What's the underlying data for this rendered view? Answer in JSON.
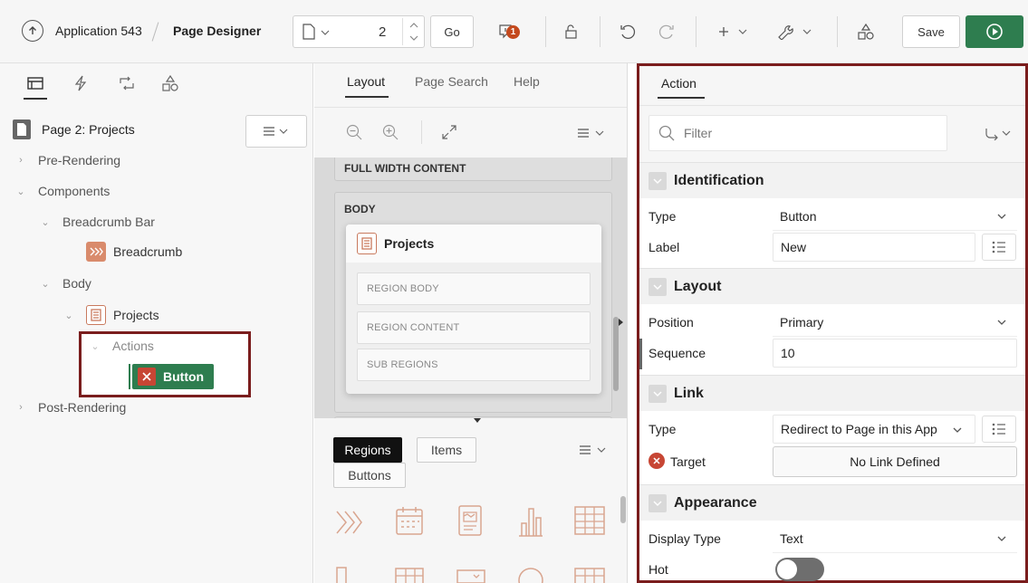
{
  "toolbar": {
    "app_label": "Application 543",
    "page_label": "Page Designer",
    "page_number": "2",
    "go_label": "Go",
    "issues_count": "1",
    "save_label": "Save"
  },
  "left": {
    "page_title": "Page 2: Projects",
    "tree": {
      "pre_rendering": "Pre-Rendering",
      "components": "Components",
      "breadcrumb_bar": "Breadcrumb Bar",
      "breadcrumb": "Breadcrumb",
      "body": "Body",
      "projects": "Projects",
      "actions": "Actions",
      "button": "Button",
      "post_rendering": "Post-Rendering"
    }
  },
  "middle": {
    "tabs": [
      "Layout",
      "Page Search",
      "Help"
    ],
    "full_width": "FULL WIDTH CONTENT",
    "body": "BODY",
    "region_title": "Projects",
    "slots": [
      "REGION BODY",
      "REGION CONTENT",
      "SUB REGIONS"
    ],
    "gallery_tabs": [
      "Regions",
      "Items",
      "Buttons"
    ]
  },
  "right": {
    "tab": "Action",
    "filter_placeholder": "Filter",
    "identification": {
      "header": "Identification",
      "type_label": "Type",
      "type_value": "Button",
      "label_label": "Label",
      "label_value": "New"
    },
    "layout": {
      "header": "Layout",
      "position_label": "Position",
      "position_value": "Primary",
      "sequence_label": "Sequence",
      "sequence_value": "10"
    },
    "link": {
      "header": "Link",
      "type_label": "Type",
      "type_value": "Redirect to Page in this App",
      "target_label": "Target",
      "target_value": "No Link Defined"
    },
    "appearance": {
      "header": "Appearance",
      "display_type_label": "Display Type",
      "display_type_value": "Text",
      "hot_label": "Hot"
    }
  },
  "colors": {
    "accent_green": "#2e7d4f",
    "error_red": "#c74634",
    "highlight_border": "#7a1d1d",
    "region_icon": "#c97a5e"
  }
}
